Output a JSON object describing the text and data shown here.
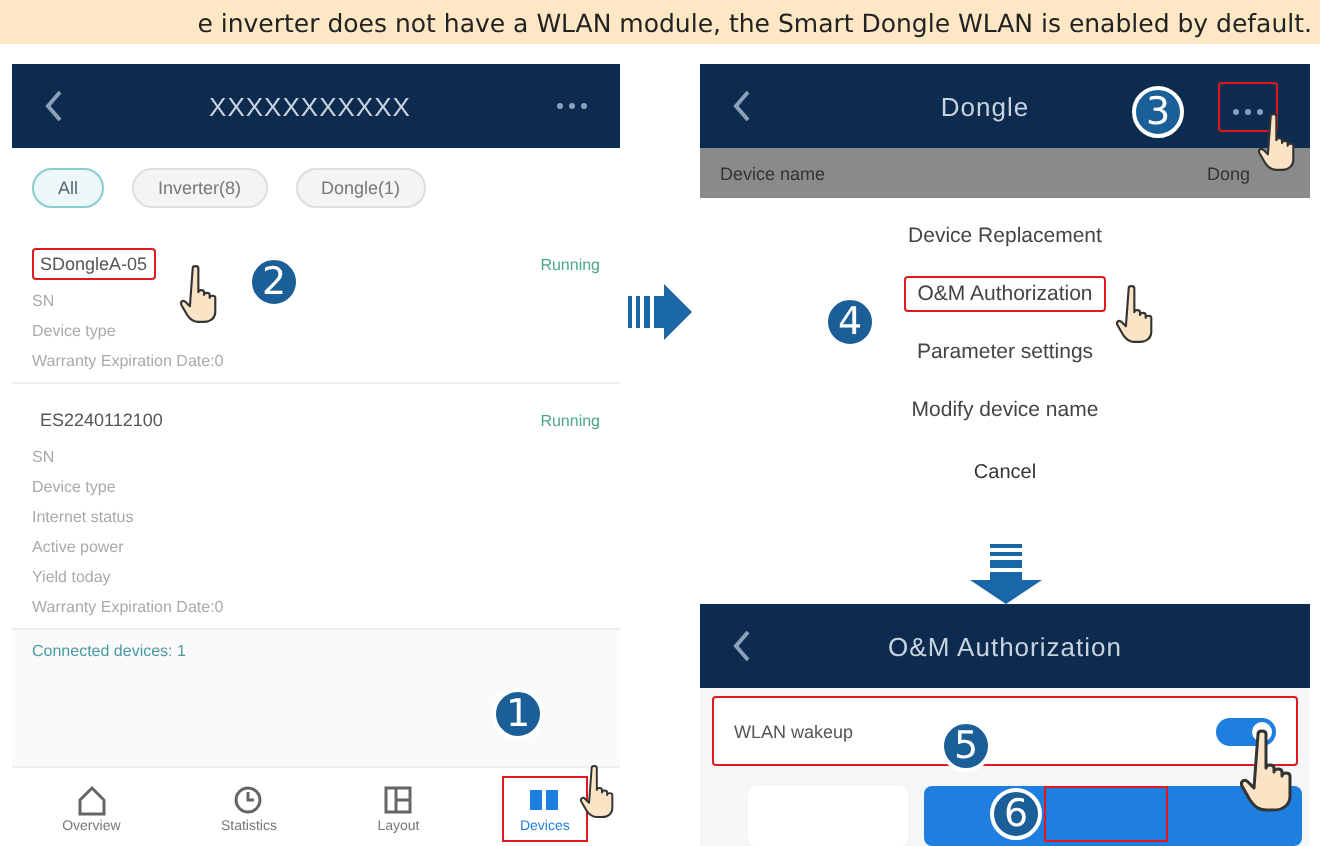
{
  "banner": "e inverter does not have a WLAN module, the Smart Dongle WLAN is enabled by default.",
  "device_list_screen": {
    "title": "XXXXXXXXXXX",
    "filters": [
      {
        "label": "All",
        "selected": true
      },
      {
        "label": "Inverter(8)",
        "selected": false
      },
      {
        "label": "Dongle(1)",
        "selected": false
      }
    ],
    "devices": [
      {
        "name": "SDongleA-05",
        "status": "Running",
        "highlighted": true,
        "step": "2",
        "fields": [
          "SN",
          "Device type",
          "Warranty Expiration Date:0"
        ]
      },
      {
        "name": "ES2240112100",
        "status": "Running",
        "highlighted": false,
        "fields": [
          "SN",
          "Device type",
          "Internet status",
          "Active power",
          "Yield today",
          "Warranty Expiration Date:0"
        ]
      }
    ],
    "link": "Connected devices: 1",
    "nav": [
      {
        "label": "Overview",
        "selected": false
      },
      {
        "label": "Statistics",
        "selected": false
      },
      {
        "label": "Layout",
        "selected": false
      },
      {
        "label": "Devices",
        "selected": true,
        "step": "1"
      }
    ]
  },
  "dongle_screen": {
    "title": "Dongle",
    "menu_step": "3",
    "row_label": "Device name",
    "row_value": "Dong",
    "menu": [
      {
        "label": "Device Replacement",
        "highlighted": false
      },
      {
        "label": "O&M Authorization",
        "highlighted": true,
        "step": "4"
      },
      {
        "label": "Parameter settings",
        "highlighted": false
      },
      {
        "label": "Modify device name",
        "highlighted": false
      }
    ],
    "cancel": "Cancel"
  },
  "authorization_screen": {
    "title": "O&M Authorization",
    "toggle_label": "WLAN wakeup",
    "on": true,
    "toggle_step": "5",
    "button_step": "6"
  }
}
